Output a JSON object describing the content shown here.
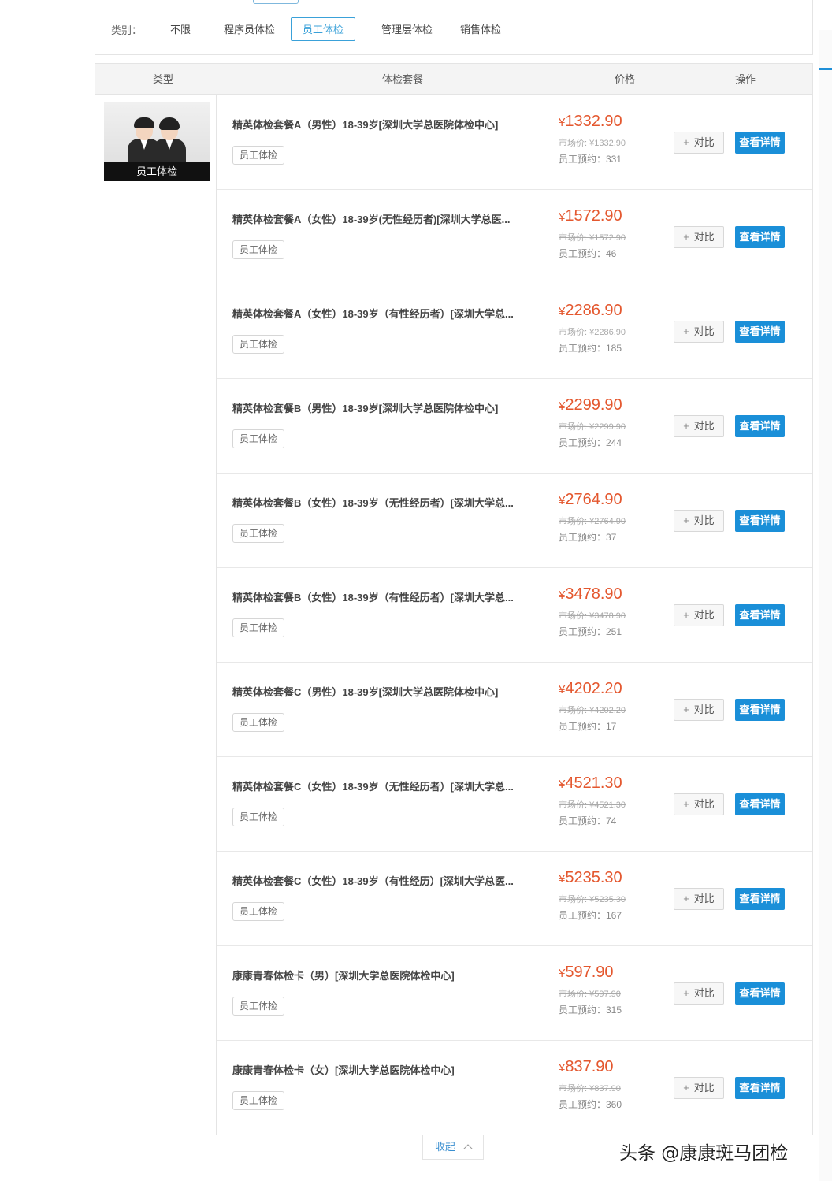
{
  "filter": {
    "label": "类别：",
    "options": [
      {
        "label": "不限"
      },
      {
        "label": "程序员体检"
      },
      {
        "label": "员工体检"
      },
      {
        "label": "管理层体检"
      },
      {
        "label": "销售体检"
      }
    ],
    "selected": "员工体检"
  },
  "table": {
    "headers": {
      "type": "类型",
      "package": "体检套餐",
      "price": "价格",
      "action": "操作"
    },
    "type_caption": "员工体检",
    "rows": [
      {
        "name": "精英体检套餐A（男性）18-39岁[深圳大学总医院体检中心]",
        "tag": "员工体检",
        "price": "1332.90",
        "market": "市场价: ¥1332.90",
        "booked": "员工预约：331"
      },
      {
        "name": "精英体检套餐A（女性）18-39岁(无性经历者)[深圳大学总医...",
        "tag": "员工体检",
        "price": "1572.90",
        "market": "市场价: ¥1572.90",
        "booked": "员工预约：46"
      },
      {
        "name": "精英体检套餐A（女性）18-39岁（有性经历者）[深圳大学总...",
        "tag": "员工体检",
        "price": "2286.90",
        "market": "市场价: ¥2286.90",
        "booked": "员工预约：185"
      },
      {
        "name": "精英体检套餐B（男性）18-39岁[深圳大学总医院体检中心]",
        "tag": "员工体检",
        "price": "2299.90",
        "market": "市场价: ¥2299.90",
        "booked": "员工预约：244"
      },
      {
        "name": "精英体检套餐B（女性）18-39岁（无性经历者）[深圳大学总...",
        "tag": "员工体检",
        "price": "2764.90",
        "market": "市场价: ¥2764.90",
        "booked": "员工预约：37"
      },
      {
        "name": "精英体检套餐B（女性）18-39岁（有性经历者）[深圳大学总...",
        "tag": "员工体检",
        "price": "3478.90",
        "market": "市场价: ¥3478.90",
        "booked": "员工预约：251"
      },
      {
        "name": "精英体检套餐C（男性）18-39岁[深圳大学总医院体检中心]",
        "tag": "员工体检",
        "price": "4202.20",
        "market": "市场价: ¥4202.20",
        "booked": "员工预约：17"
      },
      {
        "name": "精英体检套餐C（女性）18-39岁（无性经历者）[深圳大学总...",
        "tag": "员工体检",
        "price": "4521.30",
        "market": "市场价: ¥4521.30",
        "booked": "员工预约：74"
      },
      {
        "name": "精英体检套餐C（女性）18-39岁（有性经历）[深圳大学总医...",
        "tag": "员工体检",
        "price": "5235.30",
        "market": "市场价: ¥5235.30",
        "booked": "员工预约：167"
      },
      {
        "name": "康康青春体检卡（男）[深圳大学总医院体检中心]",
        "tag": "员工体检",
        "price": "597.90",
        "market": "市场价: ¥597.90",
        "booked": "员工预约：315"
      },
      {
        "name": "康康青春体检卡（女）[深圳大学总医院体检中心]",
        "tag": "员工体检",
        "price": "837.90",
        "market": "市场价: ¥837.90",
        "booked": "员工预约：360"
      }
    ],
    "compare_label": "对比",
    "detail_label": "查看详情",
    "currency": "¥"
  },
  "collapse_label": "收起",
  "watermark": "头条 @康康斑马团检",
  "colors": {
    "accent": "#1a8fd8",
    "price": "#e4572e",
    "active_filter": "#3aa1d9"
  }
}
